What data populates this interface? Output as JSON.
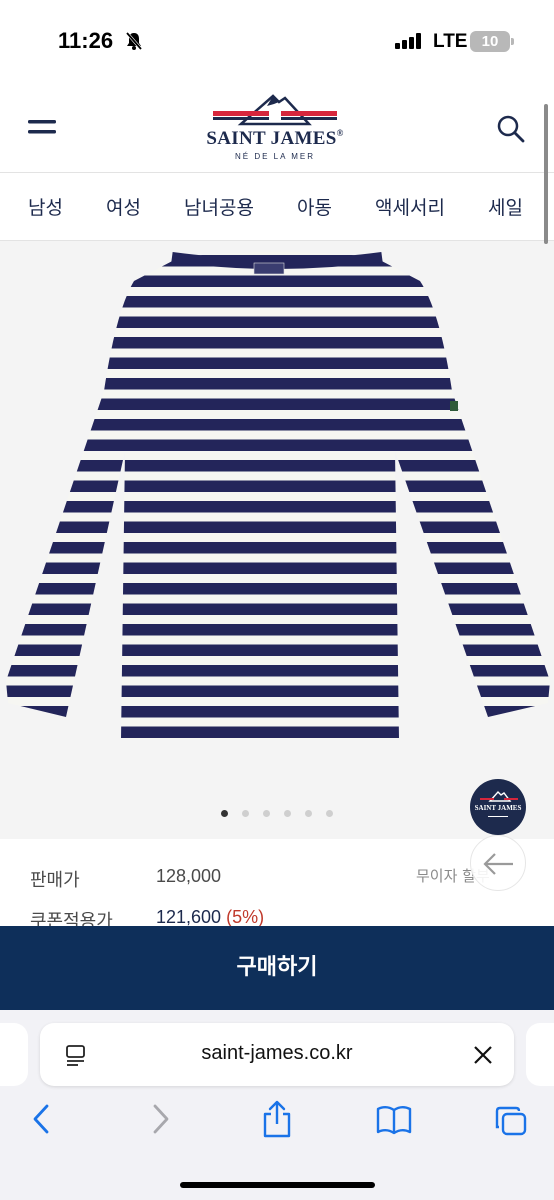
{
  "status_bar": {
    "time": "11:26",
    "network": "LTE",
    "battery": "10"
  },
  "header": {
    "brand": "SAINT JAMES",
    "brand_mark": "®",
    "tagline": "NÉ DE LA MER"
  },
  "nav": {
    "items": [
      "남성",
      "여성",
      "남녀공용",
      "아동",
      "액세서리",
      "세일"
    ]
  },
  "product": {
    "image_alt": "navy and white striped boat neck long sleeve shirt",
    "carousel": {
      "count": 6,
      "active": 1
    }
  },
  "badge": {
    "text": "SAINT JAMES"
  },
  "pricing": {
    "sale_label": "판매가",
    "sale_price": "128,000",
    "coupon_label": "쿠폰적용가",
    "coupon_price": "121,600",
    "coupon_rate": "(5%)",
    "installment": "무이자 할부"
  },
  "buy_button": {
    "label": "구매하기"
  },
  "browser": {
    "url": "saint-james.co.kr"
  },
  "colors": {
    "navy": "#1d2a4d",
    "buy_bg": "#0e2f5a",
    "flag_red": "#d6263c",
    "sale_red": "#c0392b"
  }
}
